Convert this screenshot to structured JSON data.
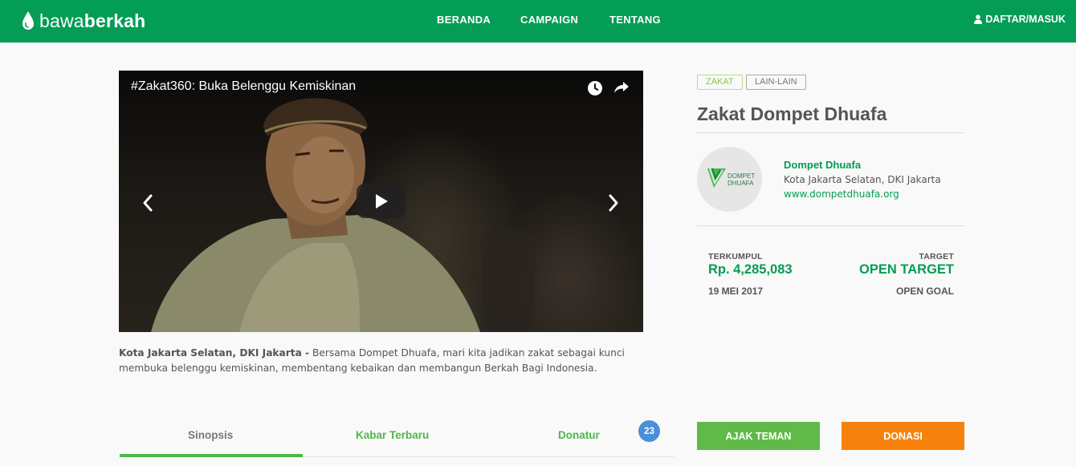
{
  "brand": {
    "logo_light": "bawa",
    "logo_bold": "berkah",
    "color": "#039d55"
  },
  "nav": {
    "items": [
      "BERANDA",
      "CAMPAIGN",
      "TENTANG"
    ],
    "login": "DAFTAR/MASUK"
  },
  "video": {
    "title": "#Zakat360: Buka Belenggu Kemiskinan"
  },
  "caption": {
    "location": "Kota Jakarta Selatan, DKI Jakarta -",
    "text": " Bersama Dompet Dhuafa, mari kita jadikan zakat sebagai kunci membuka belenggu kemiskinan, membentang kebaikan dan membangun Berkah Bagi Indonesia."
  },
  "tabs": [
    {
      "label": "Sinopsis"
    },
    {
      "label": "Kabar Terbaru"
    },
    {
      "label": "Donatur"
    }
  ],
  "donatur_count": "23",
  "tags": [
    "ZAKAT",
    "LAIN-LAIN"
  ],
  "campaign": {
    "title": "Zakat Dompet Dhuafa"
  },
  "organizer": {
    "logo_text_1": "DOMPET",
    "logo_text_2": "DHUAFA",
    "name": "Dompet Dhuafa",
    "location": "Kota Jakarta Selatan, DKI Jakarta",
    "website": "www.dompetdhuafa.org"
  },
  "stats": {
    "collected_label": "TERKUMPUL",
    "collected_value": "Rp. 4,285,083",
    "date": "19 MEI 2017",
    "target_label": "TARGET",
    "target_value": "OPEN TARGET",
    "goal": "OPEN GOAL"
  },
  "buttons": {
    "share": "AJAK TEMAN",
    "donate": "DONASI"
  },
  "colors": {
    "green": "#039d55",
    "light_green": "#5fba47",
    "orange": "#f6820d",
    "badge_blue": "#4a8fd8"
  }
}
